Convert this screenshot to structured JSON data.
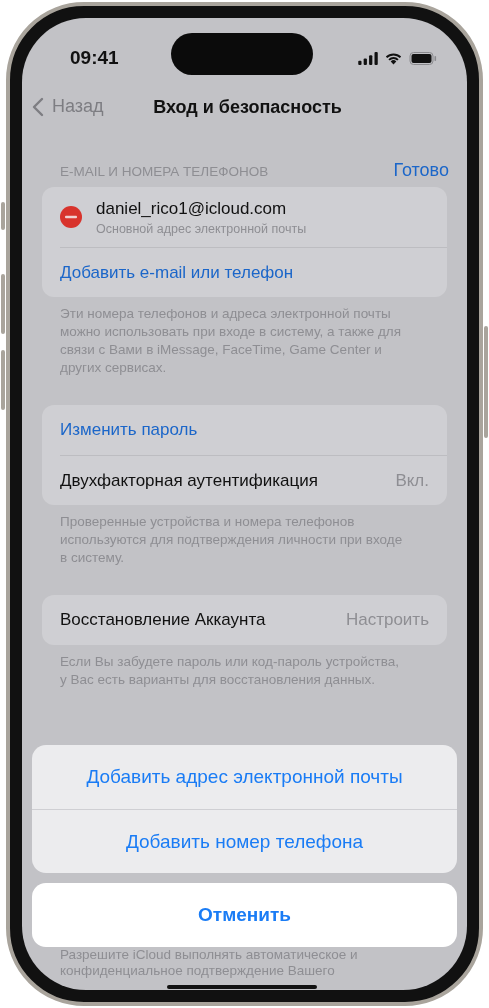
{
  "status_bar": {
    "time": "09:41"
  },
  "nav": {
    "back": "Назад",
    "title": "Вход и безопасность"
  },
  "sections": [
    {
      "header": "E-MAIL И НОМЕРА ТЕЛЕФОНОВ",
      "header_action": "Готово",
      "rows": [
        {
          "kind": "email",
          "title": "daniel_rico1@icloud.com",
          "subtitle": "Основной адрес электронной почты"
        },
        {
          "kind": "link",
          "title": "Добавить e-mail или телефон"
        }
      ],
      "footer": "Эти номера телефонов и адреса электронной почты можно использовать при входе в систему, а также для связи с Вами в iMessage, FaceTime, Game Center и других сервисах."
    },
    {
      "rows": [
        {
          "kind": "link",
          "title": "Изменить пароль"
        },
        {
          "kind": "value",
          "title": "Двухфакторная аутентификация",
          "value": "Вкл."
        }
      ],
      "footer": "Проверенные устройства и номера телефонов используются для подтверждения личности при входе в систему."
    },
    {
      "rows": [
        {
          "kind": "value",
          "title": "Восстановление Аккаунта",
          "value": "Настроить"
        }
      ],
      "footer": "Если Вы забудете пароль или код-пароль устройства, у Вас есть варианты для восстановления данных."
    },
    {
      "kind": "partial",
      "footer": "Разрешите iCloud выполнять автоматическое и конфиденциальное подтверждение Вашего"
    }
  ],
  "action_sheet": {
    "actions": [
      "Добавить адрес электронной почты",
      "Добавить номер телефона"
    ],
    "cancel": "Отменить"
  }
}
